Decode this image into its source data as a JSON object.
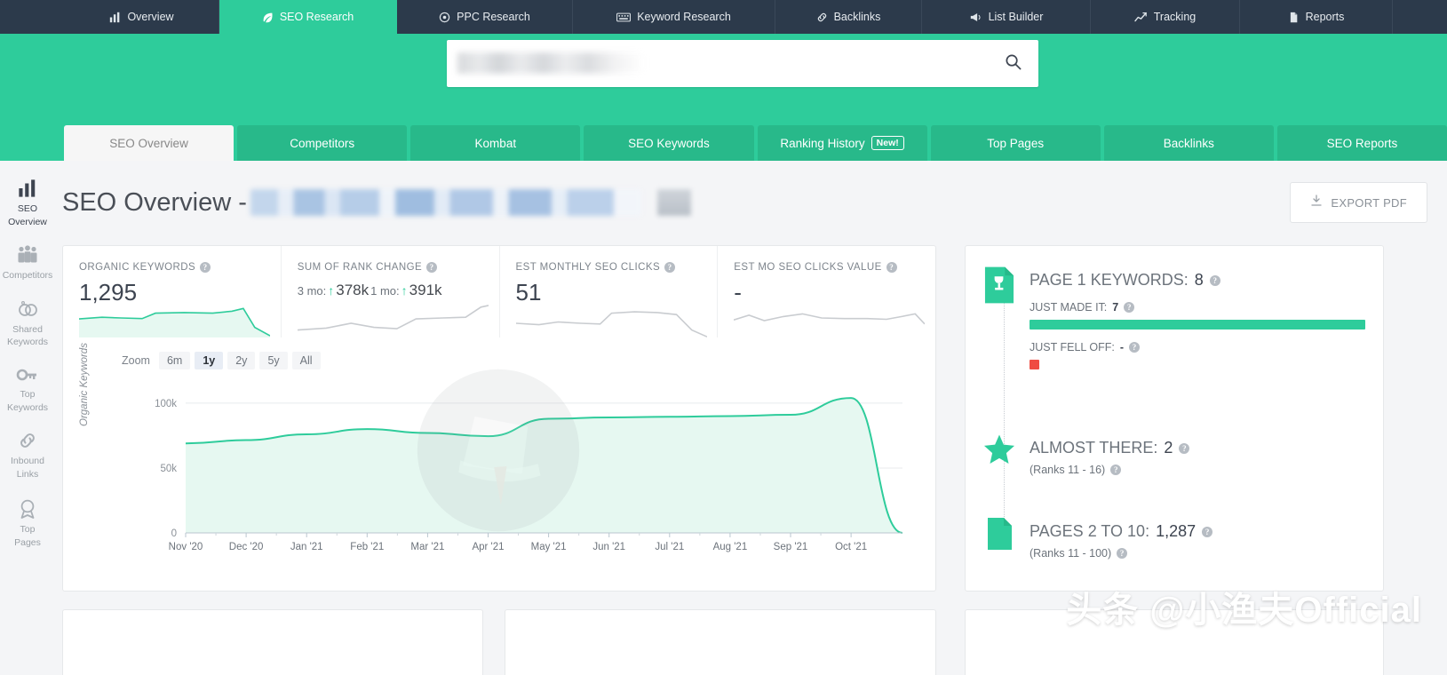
{
  "topnav": {
    "items": [
      {
        "label": "Overview",
        "icon": "bar-chart-icon",
        "active": false
      },
      {
        "label": "SEO Research",
        "icon": "leaf-icon",
        "active": true
      },
      {
        "label": "PPC Research",
        "icon": "target-icon",
        "active": false
      },
      {
        "label": "Keyword Research",
        "icon": "keyboard-icon",
        "active": false
      },
      {
        "label": "Backlinks",
        "icon": "link-icon",
        "active": false
      },
      {
        "label": "List Builder",
        "icon": "megaphone-icon",
        "active": false
      },
      {
        "label": "Tracking",
        "icon": "line-chart-icon",
        "active": false
      },
      {
        "label": "Reports",
        "icon": "document-icon",
        "active": false
      }
    ]
  },
  "search": {
    "value": "",
    "placeholder": "",
    "button_icon": "search-icon"
  },
  "subtabs": [
    {
      "label": "SEO Overview",
      "active": true,
      "badge": null
    },
    {
      "label": "Competitors",
      "active": false,
      "badge": null
    },
    {
      "label": "Kombat",
      "active": false,
      "badge": null
    },
    {
      "label": "SEO Keywords",
      "active": false,
      "badge": null
    },
    {
      "label": "Ranking History",
      "active": false,
      "badge": "New!"
    },
    {
      "label": "Top Pages",
      "active": false,
      "badge": null
    },
    {
      "label": "Backlinks",
      "active": false,
      "badge": null
    },
    {
      "label": "SEO Reports",
      "active": false,
      "badge": null
    }
  ],
  "sidebar": {
    "items": [
      {
        "label": "SEO\nOverview",
        "line1": "SEO",
        "line2": "Overview",
        "icon": "bar-chart-icon",
        "active": true
      },
      {
        "label": "Competitors",
        "line1": "Competitors",
        "line2": "",
        "icon": "people-icon",
        "active": false
      },
      {
        "label": "Shared Keywords",
        "line1": "Shared",
        "line2": "Keywords",
        "icon": "venn-icon",
        "active": false
      },
      {
        "label": "Top Keywords",
        "line1": "Top",
        "line2": "Keywords",
        "icon": "key-icon",
        "active": false
      },
      {
        "label": "Inbound Links",
        "line1": "Inbound",
        "line2": "Links",
        "icon": "link-icon",
        "active": false
      },
      {
        "label": "Top Pages",
        "line1": "Top",
        "line2": "Pages",
        "icon": "award-icon",
        "active": false
      }
    ]
  },
  "header": {
    "title_prefix": "SEO Overview -",
    "domain_redacted": true,
    "export_label": "EXPORT PDF",
    "export_icon": "pdf-icon"
  },
  "kpis": [
    {
      "label": "ORGANIC KEYWORDS",
      "value": "1,295",
      "help_icon": "question-icon",
      "spark_color": "#2ecc9b",
      "type": "value"
    },
    {
      "label": "SUM OF RANK CHANGE",
      "help_icon": "question-icon",
      "type": "rank",
      "rank_3mo_label": "3 mo:",
      "rank_3mo_value": "378k",
      "rank_1mo_label": "1 mo:",
      "rank_1mo_value": "391k",
      "arrow": "↑",
      "spark_color": "#c9ccd0"
    },
    {
      "label": "EST MONTHLY SEO CLICKS",
      "value": "51",
      "help_icon": "question-icon",
      "spark_color": "#c9ccd0",
      "type": "value"
    },
    {
      "label": "EST MO SEO CLICKS VALUE",
      "value": "-",
      "help_icon": "question-icon",
      "spark_color": "#c9ccd0",
      "type": "value"
    }
  ],
  "zoom_controls": {
    "label": "Zoom",
    "options": [
      {
        "label": "6m",
        "active": false
      },
      {
        "label": "1y",
        "active": true
      },
      {
        "label": "2y",
        "active": false
      },
      {
        "label": "5y",
        "active": false
      },
      {
        "label": "All",
        "active": false
      }
    ]
  },
  "chart_data": {
    "type": "area",
    "title": "",
    "ylabel": "Organic Keywords",
    "xlabel": "",
    "ylim": [
      0,
      115000
    ],
    "yticks": [
      0,
      50000,
      100000
    ],
    "ytick_labels": [
      "0",
      "50k",
      "100k"
    ],
    "grid": true,
    "legend": "none",
    "line_color": "#2ecc9b",
    "fill_color": "#e6f8f1",
    "categories": [
      "Nov '20",
      "Dec '20",
      "Jan '21",
      "Feb '21",
      "Mar '21",
      "Apr '21",
      "May '21",
      "Jun '21",
      "Jul '21",
      "Aug '21",
      "Sep '21",
      "Oct '21"
    ],
    "series": [
      {
        "name": "Organic Keywords",
        "values": [
          69000,
          71500,
          76000,
          80000,
          77000,
          74500,
          88000,
          89000,
          89500,
          90000,
          91000,
          104000
        ]
      }
    ],
    "x": [
      0,
      1,
      2,
      3,
      4,
      5,
      6,
      7,
      8,
      9,
      10,
      11,
      11.85
    ],
    "y": [
      69000,
      71500,
      76000,
      80000,
      77000,
      74500,
      88000,
      89000,
      89500,
      90000,
      91000,
      104000,
      0
    ]
  },
  "right_panel": {
    "blocks": [
      {
        "icon": "trophy-page-icon",
        "title_label": "PAGE 1 KEYWORDS:",
        "title_value": "8",
        "help_icon": "question-icon",
        "sub": [
          {
            "label": "JUST MADE IT:",
            "value": "7",
            "help_icon": "question-icon",
            "bar": "green",
            "bar_pct": 100
          },
          {
            "label": "JUST FELL OFF:",
            "value": "-",
            "help_icon": "question-icon",
            "bar": "red",
            "bar_pct": 3
          }
        ]
      },
      {
        "icon": "star-icon",
        "title_label": "ALMOST THERE:",
        "title_value": "2",
        "paren": "(Ranks 11 - 16)",
        "help_icon": "question-icon",
        "sub": []
      },
      {
        "icon": "page-icon",
        "title_label": "PAGES 2 TO 10:",
        "title_value": "1,287",
        "paren": "(Ranks 11 - 100)",
        "help_icon": "question-icon",
        "sub": []
      }
    ]
  },
  "watermark": {
    "text": "头条 @小渔夫Official"
  },
  "colors": {
    "brand_green": "#2ecc9b",
    "nav_dark": "#2c3a4b",
    "red": "#ef4c43",
    "page_bg": "#f4f5f7"
  }
}
